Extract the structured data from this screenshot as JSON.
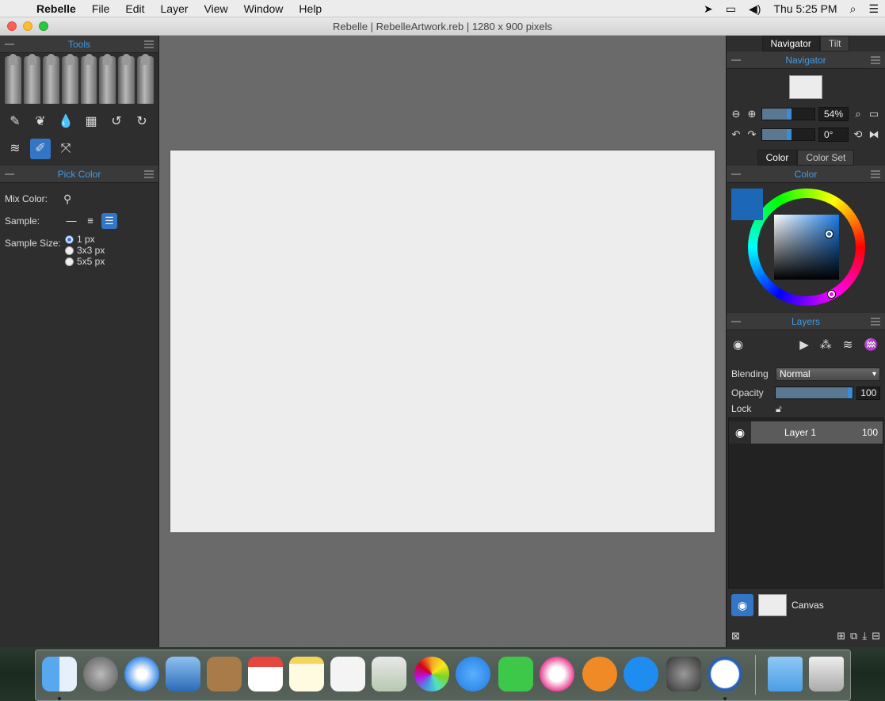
{
  "menubar": {
    "apple": "",
    "app": "Rebelle",
    "items": [
      "File",
      "Edit",
      "Layer",
      "View",
      "Window",
      "Help"
    ],
    "clock": "Thu 5:25 PM"
  },
  "window": {
    "title": "Rebelle | RebelleArtwork.reb | 1280 x 900 pixels"
  },
  "left": {
    "tools_title": "Tools",
    "pick_title": "Pick Color",
    "mix_label": "Mix Color:",
    "sample_label": "Sample:",
    "sample_size_label": "Sample Size:",
    "sizes": [
      "1 px",
      "3x3 px",
      "5x5 px"
    ]
  },
  "right": {
    "tab_navigator": "Navigator",
    "tab_tilt": "Tilt",
    "navigator_title": "Navigator",
    "zoom": "54%",
    "rotation": "0°",
    "tab_color": "Color",
    "tab_colorset": "Color Set",
    "color_title": "Color",
    "layers_title": "Layers",
    "blending_label": "Blending",
    "blending_value": "Normal",
    "opacity_label": "Opacity",
    "opacity_value": "100",
    "lock_label": "Lock",
    "layer_name": "Layer 1",
    "layer_opacity": "100",
    "canvas_label": "Canvas"
  },
  "colors": {
    "accent": "#3476c6",
    "current_color": "#1c68b7"
  }
}
